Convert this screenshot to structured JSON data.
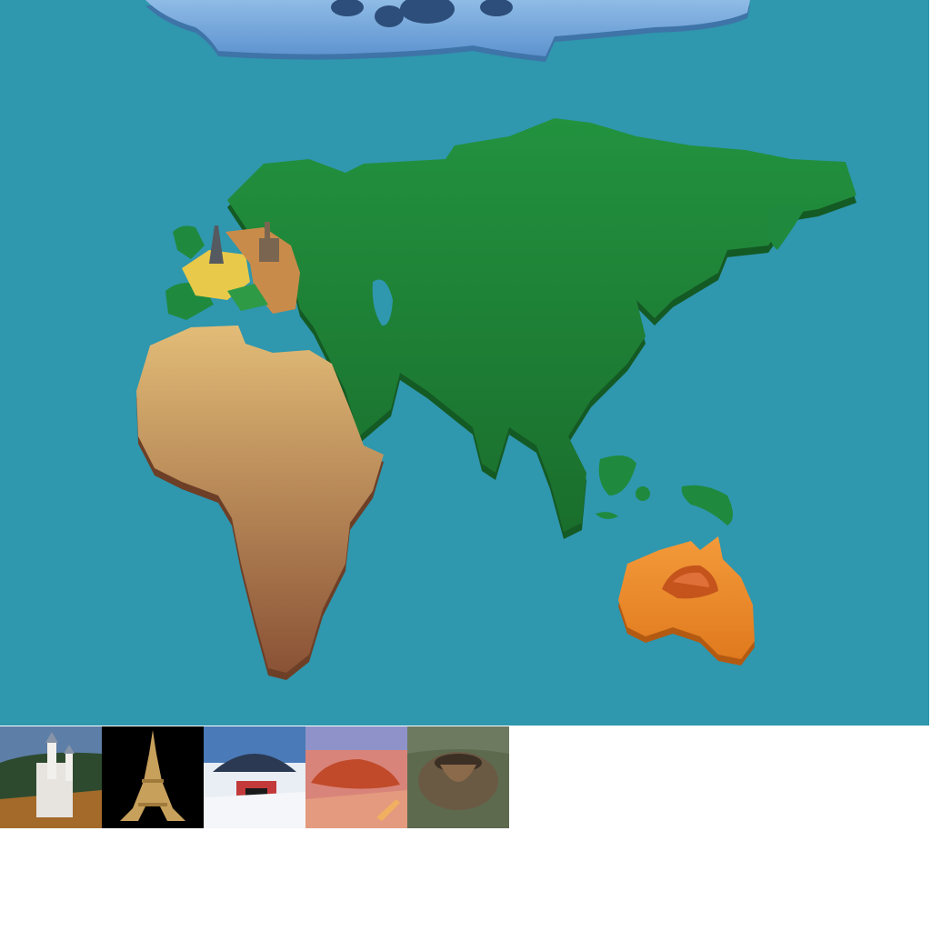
{
  "map": {
    "colors": {
      "ocean": "#2f97ae",
      "antarctica": "#6fa3d8",
      "eurasia": "#1f8a3e",
      "africa": "#d6ad6a",
      "australia": "#ef8a2c",
      "europe_west": "#e8c94a",
      "europe_central": "#c98b4a"
    }
  },
  "tray": {
    "thumbnails": [
      {
        "subject": "castle-photo"
      },
      {
        "subject": "eiffel-tower-photo"
      },
      {
        "subject": "polar-dome-station-photo"
      },
      {
        "subject": "uluru-rock-photo"
      },
      {
        "subject": "volcano-crater-photo"
      }
    ]
  }
}
